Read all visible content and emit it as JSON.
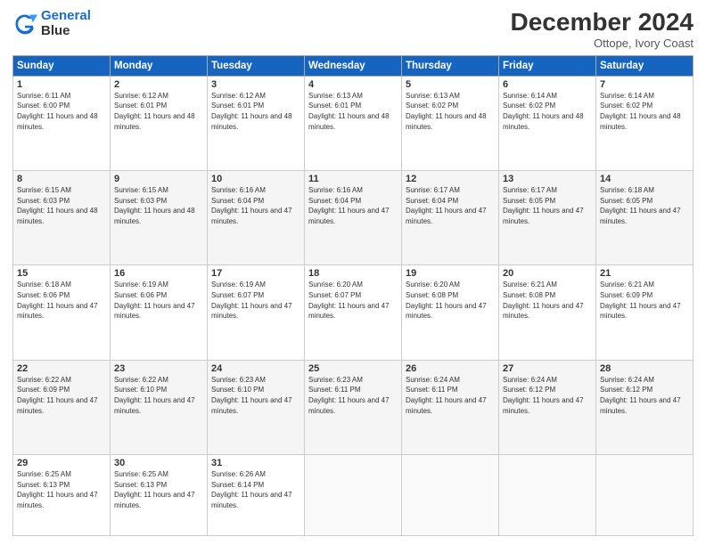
{
  "header": {
    "logo_line1": "General",
    "logo_line2": "Blue",
    "month": "December 2024",
    "location": "Ottope, Ivory Coast"
  },
  "days_of_week": [
    "Sunday",
    "Monday",
    "Tuesday",
    "Wednesday",
    "Thursday",
    "Friday",
    "Saturday"
  ],
  "weeks": [
    [
      {
        "day": "1",
        "sunrise": "6:11 AM",
        "sunset": "6:00 PM",
        "daylight": "11 hours and 48 minutes."
      },
      {
        "day": "2",
        "sunrise": "6:12 AM",
        "sunset": "6:01 PM",
        "daylight": "11 hours and 48 minutes."
      },
      {
        "day": "3",
        "sunrise": "6:12 AM",
        "sunset": "6:01 PM",
        "daylight": "11 hours and 48 minutes."
      },
      {
        "day": "4",
        "sunrise": "6:13 AM",
        "sunset": "6:01 PM",
        "daylight": "11 hours and 48 minutes."
      },
      {
        "day": "5",
        "sunrise": "6:13 AM",
        "sunset": "6:02 PM",
        "daylight": "11 hours and 48 minutes."
      },
      {
        "day": "6",
        "sunrise": "6:14 AM",
        "sunset": "6:02 PM",
        "daylight": "11 hours and 48 minutes."
      },
      {
        "day": "7",
        "sunrise": "6:14 AM",
        "sunset": "6:02 PM",
        "daylight": "11 hours and 48 minutes."
      }
    ],
    [
      {
        "day": "8",
        "sunrise": "6:15 AM",
        "sunset": "6:03 PM",
        "daylight": "11 hours and 48 minutes."
      },
      {
        "day": "9",
        "sunrise": "6:15 AM",
        "sunset": "6:03 PM",
        "daylight": "11 hours and 48 minutes."
      },
      {
        "day": "10",
        "sunrise": "6:16 AM",
        "sunset": "6:04 PM",
        "daylight": "11 hours and 47 minutes."
      },
      {
        "day": "11",
        "sunrise": "6:16 AM",
        "sunset": "6:04 PM",
        "daylight": "11 hours and 47 minutes."
      },
      {
        "day": "12",
        "sunrise": "6:17 AM",
        "sunset": "6:04 PM",
        "daylight": "11 hours and 47 minutes."
      },
      {
        "day": "13",
        "sunrise": "6:17 AM",
        "sunset": "6:05 PM",
        "daylight": "11 hours and 47 minutes."
      },
      {
        "day": "14",
        "sunrise": "6:18 AM",
        "sunset": "6:05 PM",
        "daylight": "11 hours and 47 minutes."
      }
    ],
    [
      {
        "day": "15",
        "sunrise": "6:18 AM",
        "sunset": "6:06 PM",
        "daylight": "11 hours and 47 minutes."
      },
      {
        "day": "16",
        "sunrise": "6:19 AM",
        "sunset": "6:06 PM",
        "daylight": "11 hours and 47 minutes."
      },
      {
        "day": "17",
        "sunrise": "6:19 AM",
        "sunset": "6:07 PM",
        "daylight": "11 hours and 47 minutes."
      },
      {
        "day": "18",
        "sunrise": "6:20 AM",
        "sunset": "6:07 PM",
        "daylight": "11 hours and 47 minutes."
      },
      {
        "day": "19",
        "sunrise": "6:20 AM",
        "sunset": "6:08 PM",
        "daylight": "11 hours and 47 minutes."
      },
      {
        "day": "20",
        "sunrise": "6:21 AM",
        "sunset": "6:08 PM",
        "daylight": "11 hours and 47 minutes."
      },
      {
        "day": "21",
        "sunrise": "6:21 AM",
        "sunset": "6:09 PM",
        "daylight": "11 hours and 47 minutes."
      }
    ],
    [
      {
        "day": "22",
        "sunrise": "6:22 AM",
        "sunset": "6:09 PM",
        "daylight": "11 hours and 47 minutes."
      },
      {
        "day": "23",
        "sunrise": "6:22 AM",
        "sunset": "6:10 PM",
        "daylight": "11 hours and 47 minutes."
      },
      {
        "day": "24",
        "sunrise": "6:23 AM",
        "sunset": "6:10 PM",
        "daylight": "11 hours and 47 minutes."
      },
      {
        "day": "25",
        "sunrise": "6:23 AM",
        "sunset": "6:11 PM",
        "daylight": "11 hours and 47 minutes."
      },
      {
        "day": "26",
        "sunrise": "6:24 AM",
        "sunset": "6:11 PM",
        "daylight": "11 hours and 47 minutes."
      },
      {
        "day": "27",
        "sunrise": "6:24 AM",
        "sunset": "6:12 PM",
        "daylight": "11 hours and 47 minutes."
      },
      {
        "day": "28",
        "sunrise": "6:24 AM",
        "sunset": "6:12 PM",
        "daylight": "11 hours and 47 minutes."
      }
    ],
    [
      {
        "day": "29",
        "sunrise": "6:25 AM",
        "sunset": "6:13 PM",
        "daylight": "11 hours and 47 minutes."
      },
      {
        "day": "30",
        "sunrise": "6:25 AM",
        "sunset": "6:13 PM",
        "daylight": "11 hours and 47 minutes."
      },
      {
        "day": "31",
        "sunrise": "6:26 AM",
        "sunset": "6:14 PM",
        "daylight": "11 hours and 47 minutes."
      },
      null,
      null,
      null,
      null
    ]
  ]
}
